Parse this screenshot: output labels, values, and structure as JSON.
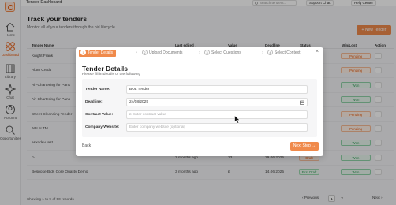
{
  "app": {
    "title": "Tender Dashboard"
  },
  "topbar": {
    "search_placeholder": "Search tenders...",
    "support_label": "Support Chat",
    "help_label": "Help Center"
  },
  "sidebar": {
    "items": [
      {
        "label": "Home",
        "icon": "home-icon"
      },
      {
        "label": "Dashboard",
        "icon": "dashboard-icon",
        "active": true
      },
      {
        "label": "Library",
        "icon": "library-icon"
      },
      {
        "label": "Chat",
        "icon": "chat-icon"
      },
      {
        "label": "Account",
        "icon": "account-icon"
      },
      {
        "label": "Opportunities",
        "icon": "opportunities-icon"
      }
    ]
  },
  "page": {
    "title": "Track your tenders",
    "subtitle": "Monitor all of your tenders through the bid lifecycle",
    "new_button": "+ New Tender"
  },
  "table": {
    "headers": [
      "Tender Name",
      "Last edited ↓",
      "Value",
      "Deadline",
      "Status",
      "Win/Lost",
      "Action"
    ],
    "rows": [
      {
        "name": "Knight Frank",
        "edited": "",
        "value": "",
        "deadline": "",
        "status": "",
        "winlost": "Pending"
      },
      {
        "name": "Alum Credit",
        "edited": "",
        "value": "",
        "deadline": "",
        "status": "",
        "winlost": "Pending"
      },
      {
        "name": "Air-Chartering for Pans",
        "edited": "",
        "value": "",
        "deadline": "",
        "status": "",
        "winlost": "Won"
      },
      {
        "name": "Air-Chartering for Pans",
        "edited": "",
        "value": "",
        "deadline": "",
        "status": "",
        "winlost": "Won"
      },
      {
        "name": "Street Cleansing Tender",
        "edited": "",
        "value": "",
        "deadline": "",
        "status": "",
        "winlost": "Pending"
      },
      {
        "name": "ABLN TM",
        "edited": "",
        "value": "",
        "deadline": "",
        "status": "",
        "winlost": "Pending"
      },
      {
        "name": "asxndev test",
        "edited": "",
        "value": "",
        "deadline": "",
        "status": "",
        "winlost": "Won"
      },
      {
        "name": "cv",
        "edited": "2 months ago",
        "value": "23",
        "deadline": "29.06.2025",
        "status": "Draft",
        "winlost": "Won"
      },
      {
        "name": "Bespoke Bids Core Quality Demo",
        "edited": "3 months ago",
        "value": "£",
        "deadline": "14.06.2025",
        "status": "First Draft",
        "winlost": "Won"
      }
    ]
  },
  "pagination": {
    "info": "Showing 1 to 9 of 50 records",
    "prev": "‹ Previous",
    "pages": [
      "1",
      "2",
      "..."
    ],
    "next": "Next ›"
  },
  "modal": {
    "steps": [
      "Tender Details",
      "Upload Documents",
      "Select Questions",
      "Select Context"
    ],
    "title": "Tender Details",
    "subtitle": "Please fill in details of the following",
    "fields": [
      {
        "label": "Tender Name:",
        "value": "BOL Tender",
        "placeholder": ""
      },
      {
        "label": "Deadline:",
        "value": "24/08/2025",
        "placeholder": ""
      },
      {
        "label": "Contract Value:",
        "value": "",
        "placeholder": "£ Enter contract value"
      },
      {
        "label": "Company Website:",
        "value": "",
        "placeholder": "Enter company website (optional)"
      }
    ],
    "back_label": "Back",
    "next_label": "Next Step →"
  },
  "colors": {
    "accent": "#f08a4b",
    "won": "#2f9e58",
    "pending": "#e8590c"
  }
}
